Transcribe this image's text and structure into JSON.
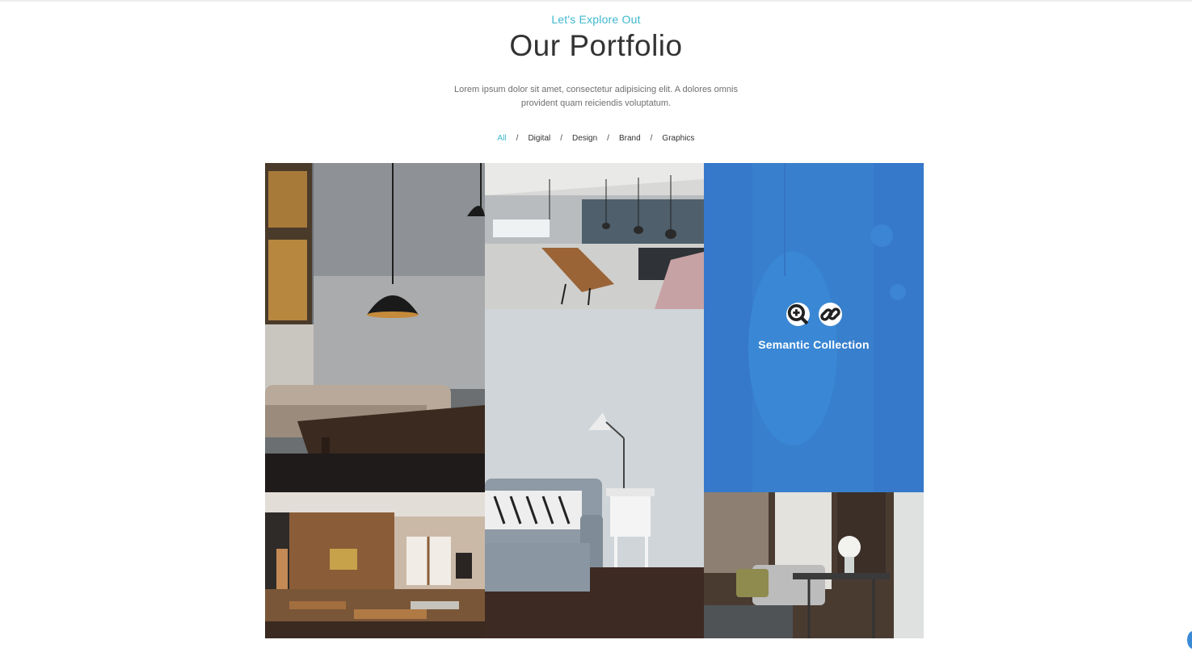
{
  "header": {
    "subtitle": "Let's Explore Out",
    "title": "Our Portfolio",
    "description": "Lorem ipsum dolor sit amet, consectetur adipisicing elit. A dolores omnis provident quam reiciendis voluptatum."
  },
  "filters": {
    "items": [
      "All",
      "Digital",
      "Design",
      "Brand",
      "Graphics"
    ],
    "separator": "/",
    "active": "All"
  },
  "portfolio": {
    "items": [
      {
        "name": "portfolio-item-cafe-pendant-lamp"
      },
      {
        "name": "portfolio-item-office-dining"
      },
      {
        "name": "portfolio-item-semantic-collection",
        "hover_title": "Semantic Collection",
        "icons": [
          "zoom-in-icon",
          "link-icon"
        ]
      },
      {
        "name": "portfolio-item-wooden-restaurant"
      },
      {
        "name": "portfolio-item-sofa-lamp"
      },
      {
        "name": "portfolio-item-window-seating"
      }
    ]
  },
  "colors": {
    "accent": "#3fb8cf",
    "overlay": "#3a80d6",
    "heading": "#333333"
  }
}
